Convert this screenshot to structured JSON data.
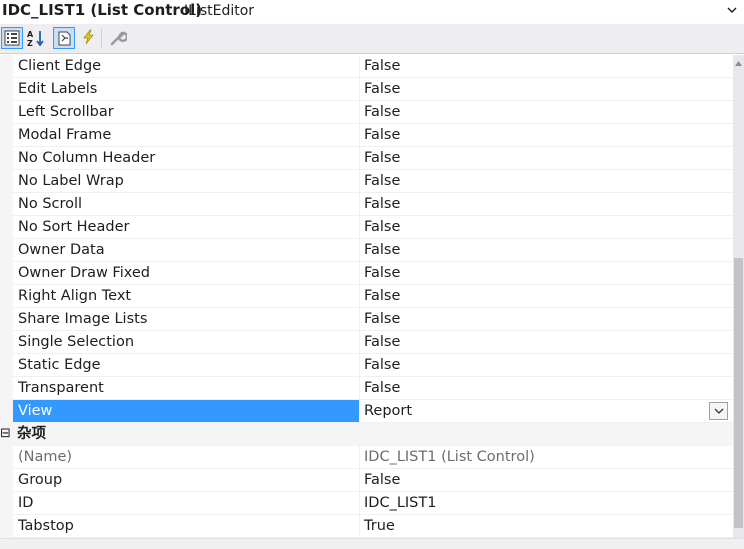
{
  "header": {
    "object_name": "IDC_LIST1 (List Control)",
    "object_type": "IListEditor"
  },
  "toolbar": {
    "buttons": [
      {
        "icon": "categorized-icon",
        "active": true
      },
      {
        "icon": "alphabetical-sort-icon",
        "active": false
      },
      {
        "icon": "properties-page-icon",
        "active": true
      },
      {
        "icon": "events-lightning-icon",
        "active": false
      },
      {
        "icon": "property-pages-wrench-icon",
        "active": false
      }
    ]
  },
  "properties": [
    {
      "name": "Client Edge",
      "value": "False"
    },
    {
      "name": "Edit Labels",
      "value": "False"
    },
    {
      "name": "Left Scrollbar",
      "value": "False"
    },
    {
      "name": "Modal Frame",
      "value": "False"
    },
    {
      "name": "No Column Header",
      "value": "False"
    },
    {
      "name": "No Label Wrap",
      "value": "False"
    },
    {
      "name": "No Scroll",
      "value": "False"
    },
    {
      "name": "No Sort Header",
      "value": "False"
    },
    {
      "name": "Owner Data",
      "value": "False"
    },
    {
      "name": "Owner Draw Fixed",
      "value": "False"
    },
    {
      "name": "Right Align Text",
      "value": "False"
    },
    {
      "name": "Share Image Lists",
      "value": "False"
    },
    {
      "name": "Single Selection",
      "value": "False"
    },
    {
      "name": "Static Edge",
      "value": "False"
    },
    {
      "name": "Transparent",
      "value": "False"
    },
    {
      "name": "View",
      "value": "Report",
      "selected": true
    }
  ],
  "misc_category": {
    "toggle": "⊟",
    "label": "杂项",
    "properties": [
      {
        "name": "(Name)",
        "value": "IDC_LIST1 (List Control)",
        "readonly": true
      },
      {
        "name": "Group",
        "value": "False"
      },
      {
        "name": "ID",
        "value": "IDC_LIST1"
      },
      {
        "name": "Tabstop",
        "value": "True"
      }
    ]
  },
  "colors": {
    "selection": "#3399ff",
    "toolbar_bg": "#eeeef2",
    "category_bg": "#f5f5f5"
  }
}
